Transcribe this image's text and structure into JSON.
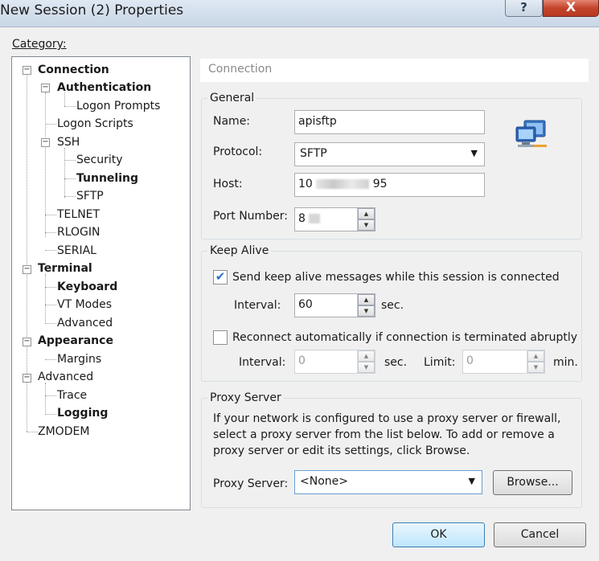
{
  "window": {
    "title": "New Session (2) Properties",
    "help_glyph": "?",
    "close_glyph": "X"
  },
  "category_label": "Category:",
  "tree": {
    "items": [
      {
        "label": "Connection",
        "bold": true
      },
      {
        "label": "Authentication",
        "bold": true
      },
      {
        "label": "Logon Prompts",
        "bold": false
      },
      {
        "label": "Logon Scripts",
        "bold": false
      },
      {
        "label": "SSH",
        "bold": false
      },
      {
        "label": "Security",
        "bold": false
      },
      {
        "label": "Tunneling",
        "bold": true
      },
      {
        "label": "SFTP",
        "bold": false
      },
      {
        "label": "TELNET",
        "bold": false
      },
      {
        "label": "RLOGIN",
        "bold": false
      },
      {
        "label": "SERIAL",
        "bold": false
      },
      {
        "label": "Terminal",
        "bold": true
      },
      {
        "label": "Keyboard",
        "bold": true
      },
      {
        "label": "VT Modes",
        "bold": false
      },
      {
        "label": "Advanced",
        "bold": false
      },
      {
        "label": "Appearance",
        "bold": true
      },
      {
        "label": "Margins",
        "bold": false
      },
      {
        "label": "Advanced",
        "bold": false
      },
      {
        "label": "Trace",
        "bold": false
      },
      {
        "label": "Logging",
        "bold": true
      },
      {
        "label": "ZMODEM",
        "bold": false
      }
    ],
    "expander_glyph": "−"
  },
  "panel_header": "Connection",
  "general": {
    "title": "General",
    "name_label": "Name:",
    "name_value": "apisftp",
    "protocol_label": "Protocol:",
    "protocol_value": "SFTP",
    "host_label": "Host:",
    "host_value": "10",
    "host_value_suffix": "95",
    "port_label": "Port Number:",
    "port_value": "8"
  },
  "keep_alive": {
    "title": "Keep Alive",
    "send_label": "Send keep alive messages while this session is connected",
    "send_checked": true,
    "interval_label": "Interval:",
    "interval_value": "60",
    "interval_unit": "sec.",
    "reconnect_label": "Reconnect automatically if connection is terminated abruptly",
    "reconnect_checked": false,
    "reconnect_interval_label": "Interval:",
    "reconnect_interval_value": "0",
    "reconnect_interval_unit": "sec.",
    "limit_label": "Limit:",
    "limit_value": "0",
    "limit_unit": "min."
  },
  "proxy": {
    "title": "Proxy Server",
    "description": "If your network is configured to use a proxy server or firewall, select a proxy server from the list below. To add or remove a proxy server or edit its settings, click Browse.",
    "server_label": "Proxy Server:",
    "server_value": "<None>",
    "browse_label": "Browse..."
  },
  "buttons": {
    "ok": "OK",
    "cancel": "Cancel"
  },
  "colors": {
    "checked": "#2a6fd0",
    "close_button": "#c4432b"
  }
}
